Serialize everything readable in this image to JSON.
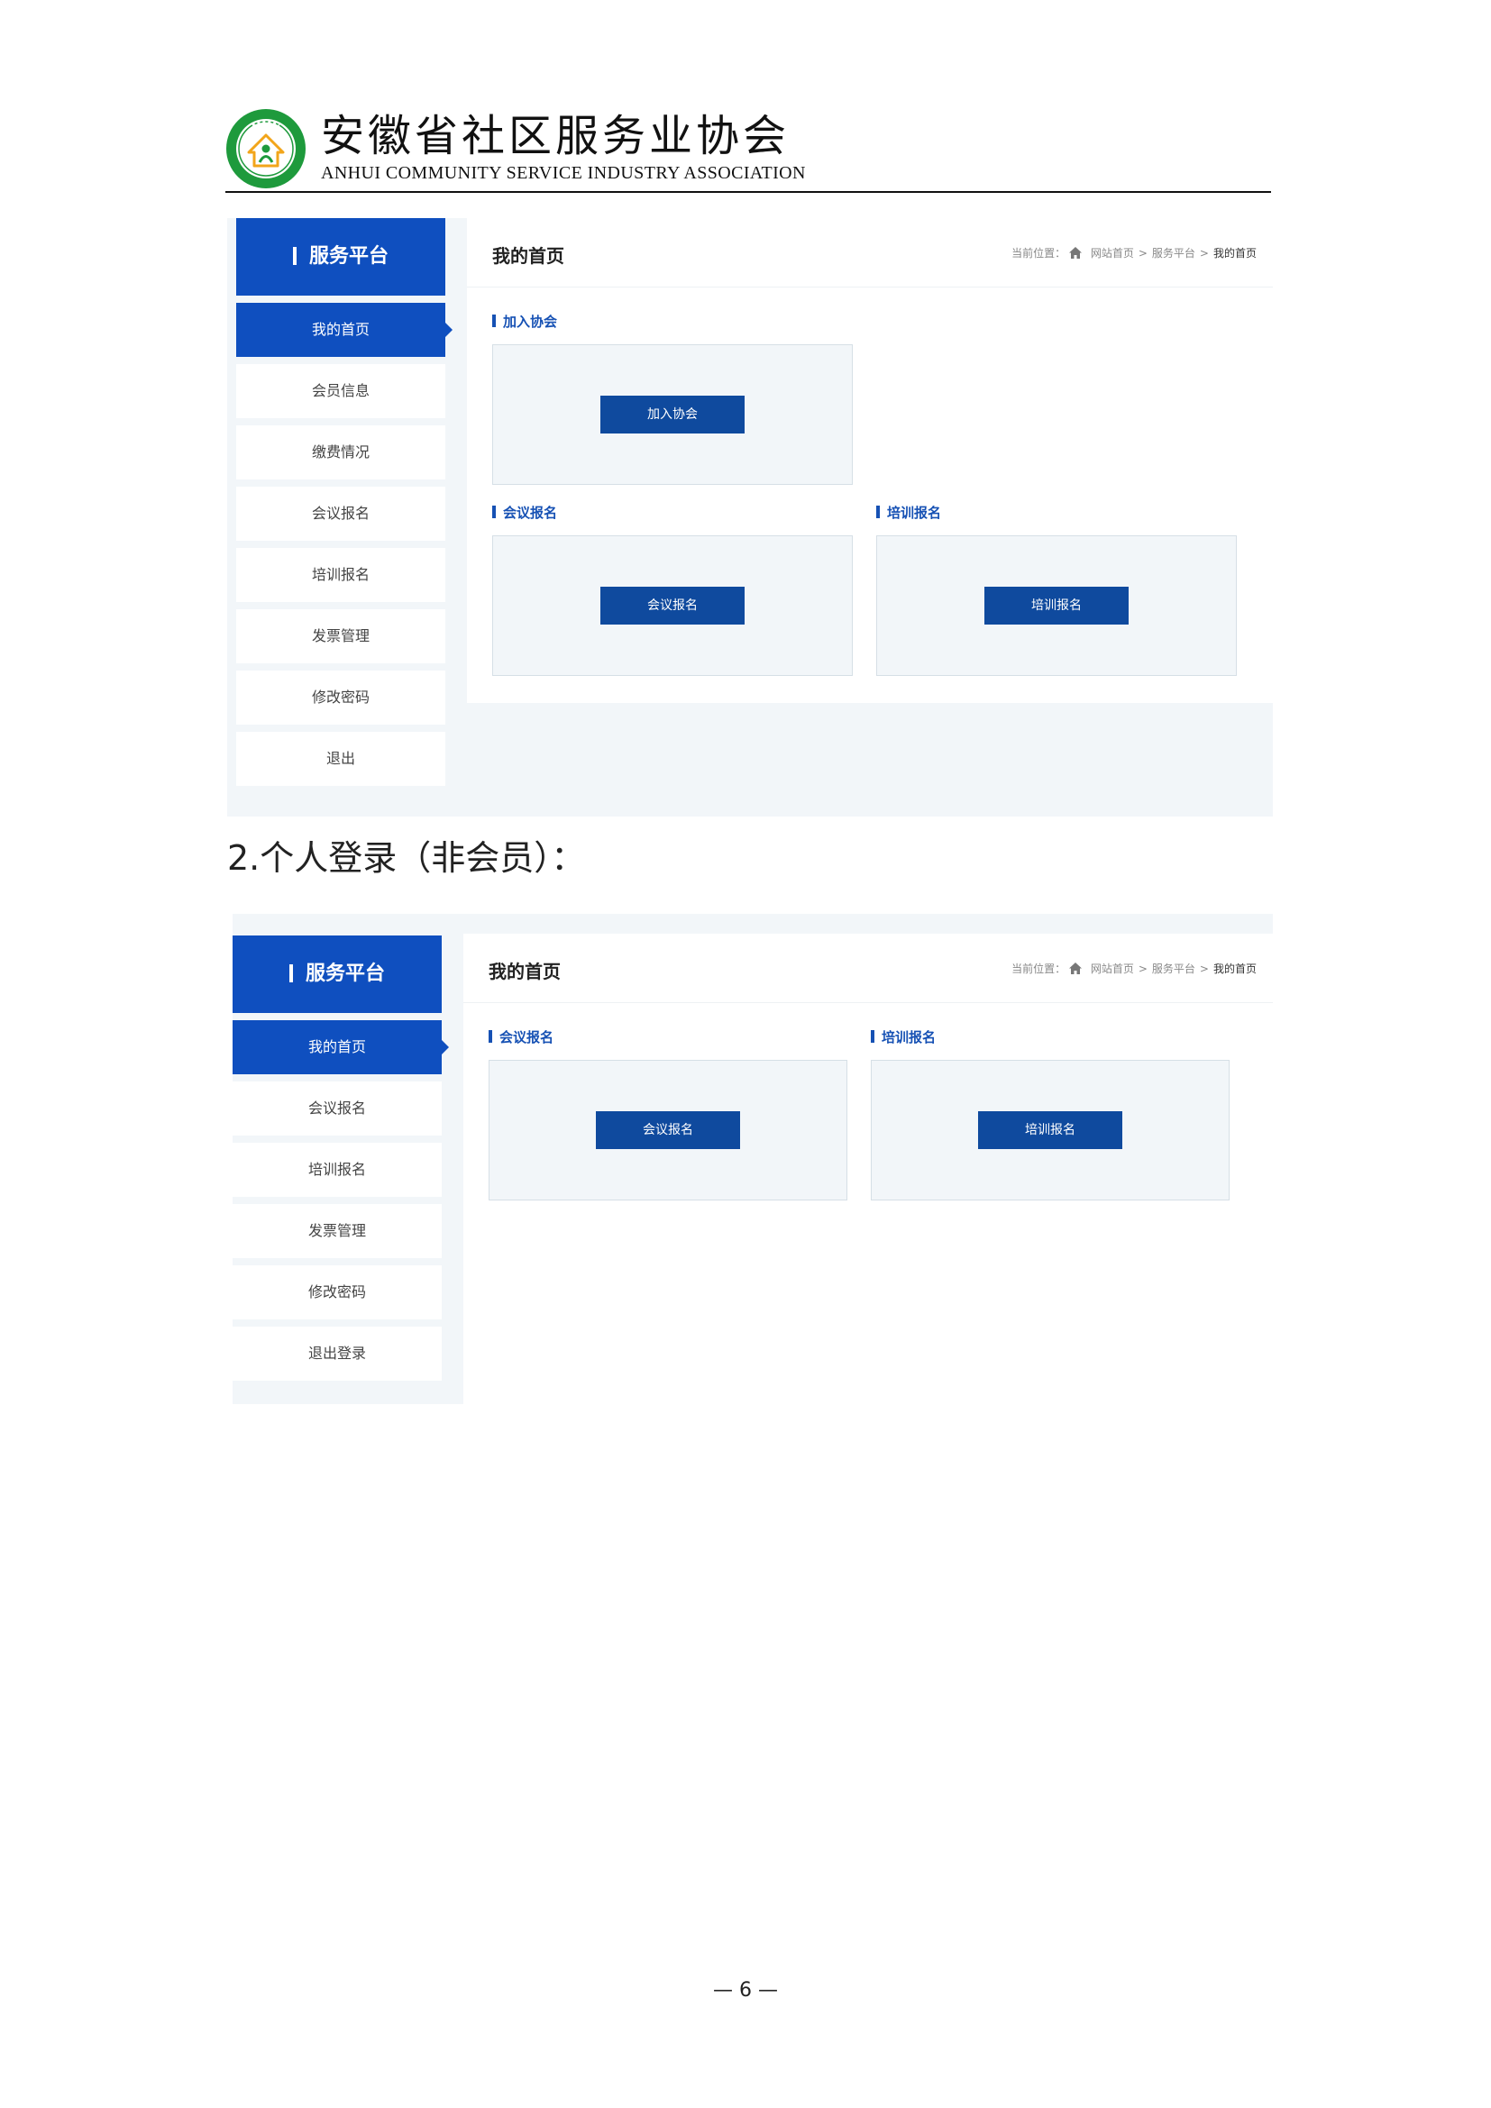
{
  "letterhead": {
    "org_name_cn": "安徽省社区服务业协会",
    "org_name_en": "ANHUI COMMUNITY SERVICE INDUSTRY ASSOCIATION",
    "logo_icon": "association-seal-icon",
    "colors": {
      "seal_green": "#1e9a3c",
      "seal_ring": "#ffffff",
      "seal_accent": "#f2a51a"
    }
  },
  "screens": {
    "member": {
      "sidebar": {
        "title": "服务平台",
        "items": [
          {
            "label": "我的首页",
            "active": true
          },
          {
            "label": "会员信息"
          },
          {
            "label": "缴费情况"
          },
          {
            "label": "会议报名"
          },
          {
            "label": "培训报名"
          },
          {
            "label": "发票管理"
          },
          {
            "label": "修改密码"
          },
          {
            "label": "退出"
          }
        ]
      },
      "panel": {
        "title": "我的首页",
        "breadcrumb": {
          "prefix": "当前位置：",
          "items": [
            "网站首页",
            "服务平台",
            "我的首页"
          ],
          "separator": ">"
        },
        "sections": [
          {
            "label": "加入协会",
            "button": "加入协会"
          },
          {
            "label": "会议报名",
            "button": "会议报名"
          },
          {
            "label": "培训报名",
            "button": "培训报名"
          }
        ]
      }
    },
    "personal": {
      "sidebar": {
        "title": "服务平台",
        "items": [
          {
            "label": "我的首页",
            "active": true
          },
          {
            "label": "会议报名"
          },
          {
            "label": "培训报名"
          },
          {
            "label": "发票管理"
          },
          {
            "label": "修改密码"
          },
          {
            "label": "退出登录"
          }
        ]
      },
      "panel": {
        "title": "我的首页",
        "breadcrumb": {
          "prefix": "当前位置：",
          "items": [
            "网站首页",
            "服务平台",
            "我的首页"
          ],
          "separator": ">"
        },
        "sections": [
          {
            "label": "会议报名",
            "button": "会议报名"
          },
          {
            "label": "培训报名",
            "button": "培训报名"
          }
        ]
      }
    }
  },
  "document": {
    "subheading": "2.个人登录（非会员）：",
    "page_number": "— 6 —"
  },
  "colors": {
    "primary_blue": "#0f4fbf",
    "button_blue": "#0f4a9e",
    "label_blue": "#1651b4",
    "panel_bg": "#f2f6f9"
  }
}
